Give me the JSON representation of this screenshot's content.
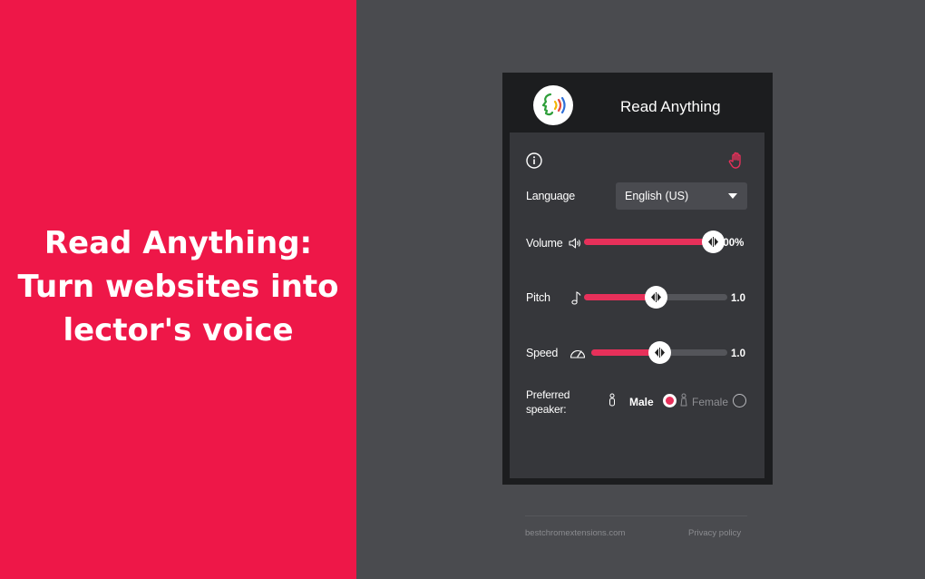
{
  "promo": {
    "headline_lines": [
      "Read Anything:",
      "Turn websites into",
      "lector's voice"
    ]
  },
  "popup": {
    "title": "Read Anything",
    "icons": {
      "logo": "speaking-head-logo",
      "info": "info-icon",
      "stop": "hand-icon"
    },
    "language": {
      "label": "Language",
      "selected": "English (US)"
    },
    "volume": {
      "label": "Volume",
      "icon": "speaker-icon",
      "value_text": "100%",
      "level": 1.0
    },
    "pitch": {
      "label": "Pitch",
      "icon": "music-note-icon",
      "value_text": "1.0",
      "level": 0.5
    },
    "speed": {
      "label": "Speed",
      "icon": "speedometer-icon",
      "value_text": "1.0",
      "level": 0.5
    },
    "speaker": {
      "label": "Preferred speaker:",
      "male_label": "Male",
      "female_label": "Female",
      "selected": "Male"
    },
    "footer": {
      "site": "bestchromextensions.com",
      "privacy": "Privacy policy"
    }
  },
  "colors": {
    "brand_red": "#ee1748",
    "accent": "#e7305a",
    "background_gray": "#4a4b4f",
    "popup_dark": "#1c1d1f",
    "popup_body": "#36373b"
  }
}
